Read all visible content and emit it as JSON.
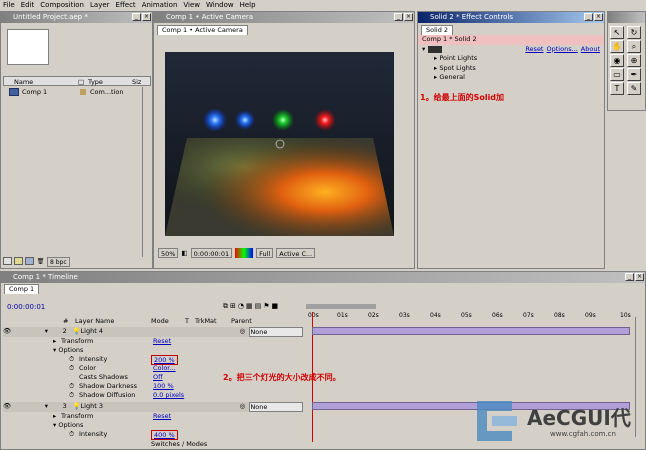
{
  "menu": [
    "File",
    "Edit",
    "Composition",
    "Layer",
    "Effect",
    "Animation",
    "View",
    "Window",
    "Help"
  ],
  "project": {
    "title": "Untitled Project.aep *",
    "col_name": "Name",
    "col_type": "Type",
    "col_size": "Siz",
    "item_name": "Comp 1",
    "item_type": "Com...tion",
    "bpc": "8 bpc"
  },
  "comp": {
    "title": "Comp 1 • Active Camera",
    "tab": "Comp 1 • Active Camera",
    "zoom": "50%",
    "timecode": "0:00:00:01",
    "resolution": "Full",
    "view": "Active C..."
  },
  "effects": {
    "title": "Solid 2 * Effect Controls",
    "tab": "Solid 2",
    "breadcrumb": "Comp 1 * Solid 2",
    "reset_label": "Reset",
    "options_label": "Options...",
    "about_label": "About",
    "items": [
      "Point Lights",
      "Spot Lights",
      "General"
    ]
  },
  "annotations": {
    "note1": "1。给最上面的Solid加",
    "note2": "2。把三个灯光的大小改成不同。"
  },
  "timeline": {
    "title": "Comp 1 * Timeline",
    "tab": "Comp 1",
    "timecode": "0:00:00:01",
    "headers": {
      "num": "#",
      "layer_name": "Layer Name",
      "mode": "Mode",
      "t": "T",
      "trkmat": "TrkMat",
      "parent": "Parent"
    },
    "ruler": [
      "00s",
      "01s",
      "02s",
      "03s",
      "04s",
      "05s",
      "06s",
      "07s",
      "08s",
      "09s",
      "10s"
    ],
    "layers": [
      {
        "num": "2",
        "name": "Light 4",
        "parent": "None"
      },
      {
        "num": "3",
        "name": "Light 3",
        "parent": "None"
      }
    ],
    "transform": "Transform",
    "options": "Options",
    "reset": "Reset",
    "props": [
      {
        "name": "Intensity",
        "value": "200 %"
      },
      {
        "name": "Color",
        "value": "Color..."
      },
      {
        "name": "Casts Shadows",
        "value": "Off"
      },
      {
        "name": "Shadow Darkness",
        "value": "100 %"
      },
      {
        "name": "Shadow Diffusion",
        "value": "0.0 pixels"
      }
    ],
    "intensity2": "400 %",
    "footer": "Switches / Modes"
  },
  "logo": {
    "text": "AeCGUI代",
    "url": "www.cgfah.com.cn"
  }
}
